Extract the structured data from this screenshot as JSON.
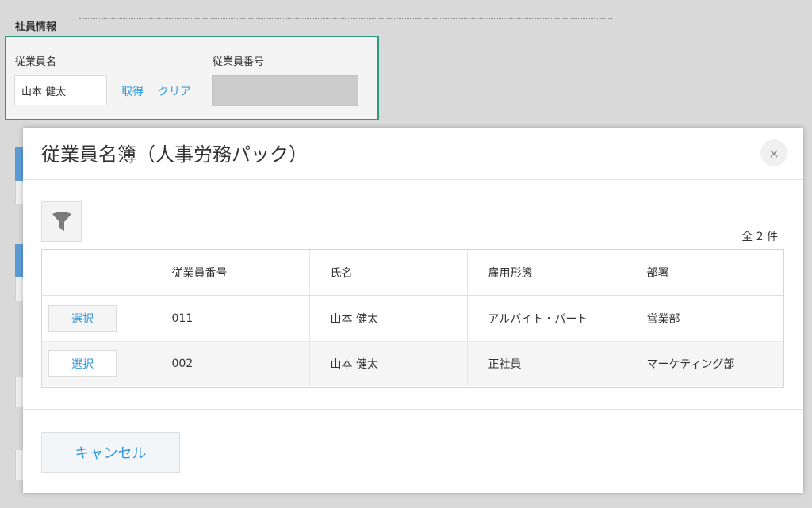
{
  "form": {
    "section_title": "社員情報",
    "employee_name_label": "従業員名",
    "employee_name_value": "山本 健太",
    "fetch_link": "取得",
    "clear_link": "クリア",
    "employee_number_label": "従業員番号",
    "employee_number_value": ""
  },
  "modal": {
    "title": "従業員名簿（人事労務パック）",
    "close_glyph": "×",
    "count": "全 2 件",
    "columns": [
      "",
      "従業員番号",
      "氏名",
      "雇用形態",
      "部署"
    ],
    "rows": [
      {
        "select": "選択",
        "number": "011",
        "name": "山本 健太",
        "employment": "アルバイト・パート",
        "department": "営業部"
      },
      {
        "select": "選択",
        "number": "002",
        "name": "山本 健太",
        "employment": "正社員",
        "department": "マーケティング部"
      }
    ],
    "cancel": "キャンセル"
  },
  "icons": {
    "filter": "funnel-icon",
    "close": "close-icon"
  },
  "colors": {
    "accent": "#3498db",
    "highlight_border": "#2b9a7e",
    "backdrop": "#d9d9d9"
  }
}
